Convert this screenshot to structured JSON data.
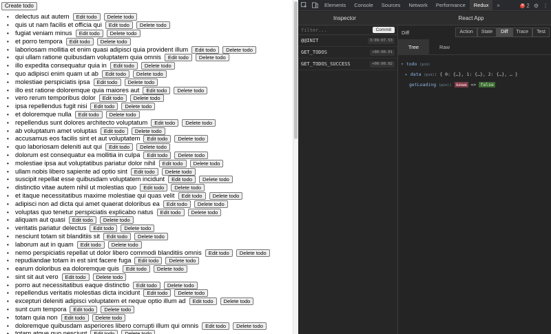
{
  "app": {
    "create_label": "Create todo",
    "edit_label": "Edit todo",
    "delete_label": "Delete todo",
    "bullet": "•",
    "todos": [
      "delectus aut autem",
      "quis ut nam facilis et officia qui",
      "fugiat veniam minus",
      "et porro tempora",
      "laboriosam mollitia et enim quasi adipisci quia provident illum",
      "qui ullam ratione quibusdam voluptatem quia omnis",
      "illo expedita consequatur quia in",
      "quo adipisci enim quam ut ab",
      "molestiae perspiciatis ipsa",
      "illo est ratione doloremque quia maiores aut",
      "vero rerum temporibus dolor",
      "ipsa repellendus fugit nisi",
      "et doloremque nulla",
      "repellendus sunt dolores architecto voluptatum",
      "ab voluptatum amet voluptas",
      "accusamus eos facilis sint et aut voluptatem",
      "quo laboriosam deleniti aut qui",
      "dolorum est consequatur ea mollitia in culpa",
      "molestiae ipsa aut voluptatibus pariatur dolor nihil",
      "ullam nobis libero sapiente ad optio sint",
      "suscipit repellat esse quibusdam voluptatem incidunt",
      "distinctio vitae autem nihil ut molestias quo",
      "et itaque necessitatibus maxime molestiae qui quas velit",
      "adipisci non ad dicta qui amet quaerat doloribus ea",
      "voluptas quo tenetur perspiciatis explicabo natus",
      "aliquam aut quasi",
      "veritatis pariatur delectus",
      "nesciunt totam sit blanditiis sit",
      "laborum aut in quam",
      "nemo perspiciatis repellat ut dolor libero commodi blanditiis omnis",
      "repudiandae totam in est sint facere fuga",
      "earum doloribus ea doloremque quis",
      "sint sit aut vero",
      "porro aut necessitatibus eaque distinctio",
      "repellendus veritatis molestias dicta incidunt",
      "excepturi deleniti adipisci voluptatem et neque optio illum ad",
      "sunt cum tempora",
      "totam quia non",
      "doloremque quibusdam asperiores libero corrupti illum qui omnis",
      "totam atque quo nesciunt"
    ]
  },
  "devtools": {
    "tabs": [
      "Elements",
      "Console",
      "Sources",
      "Network",
      "Performance",
      "Redux"
    ],
    "active_tab": "Redux",
    "more": "»",
    "error_count": "2",
    "inspector_title": "Inspector",
    "app_title": "React App",
    "filter_placeholder": "filter...",
    "commit_label": "Commit",
    "actions": [
      {
        "name": "@@INIT",
        "time": "3:09:07.53"
      },
      {
        "name": "GET_TODOS",
        "time": "+00:00.01"
      },
      {
        "name": "GET_TODOS_SUCCESS",
        "time": "+00:00.02"
      }
    ],
    "diff_label": "Diff",
    "mode_tabs": [
      "Action",
      "State",
      "Diff",
      "Trace",
      "Test"
    ],
    "active_mode": "Diff",
    "view_tabs": [
      "Tree",
      "Raw"
    ],
    "active_view": "Tree",
    "tree": {
      "root_key": "todo",
      "pin": "(pin)",
      "data_key": "data",
      "data_value": "{ 0: {…}, 1: {…}, 2: {…}, … }",
      "loading_key": "getLoading",
      "old_value": "true",
      "arrow": "=>",
      "new_value": "false"
    }
  }
}
